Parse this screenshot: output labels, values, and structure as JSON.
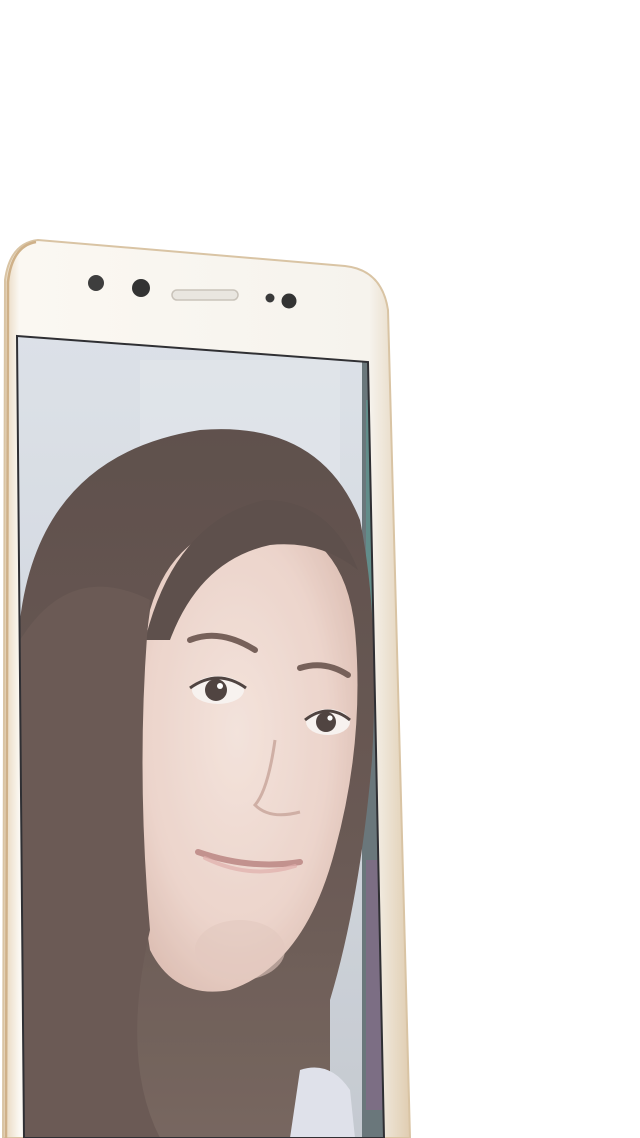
{
  "scene": {
    "subject": "smartphone-front-view",
    "screen_content": "selfie-photo",
    "colors": {
      "background": "#ffffff",
      "phone_body": "#f7f4ee",
      "phone_edge": "#e8d9c3",
      "phone_rim_gold": "#d8bf9a",
      "camera_dark": "#3b3b3b",
      "screen_bg": "#cfd5de",
      "hair": "#3a2a25",
      "skin": "#e9cfc6",
      "lips": "#c98c89"
    }
  }
}
